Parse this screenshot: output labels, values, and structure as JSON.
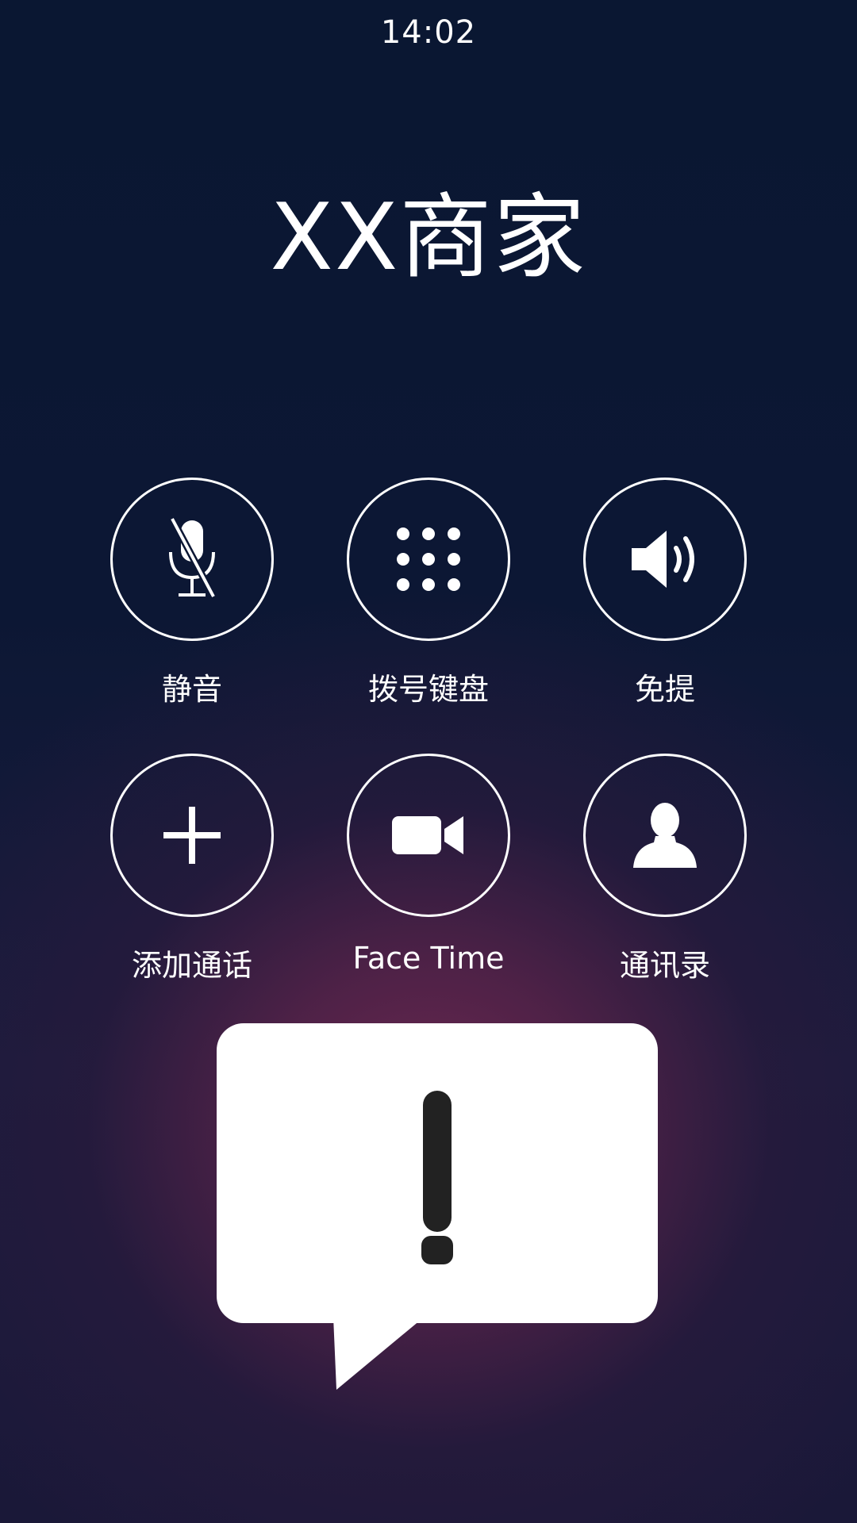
{
  "status_bar": {
    "time": "14:02"
  },
  "call": {
    "caller_name": "XX商家"
  },
  "controls": [
    {
      "label": "静音",
      "icon": "microphone-muted-icon"
    },
    {
      "label": "拨号键盘",
      "icon": "keypad-icon"
    },
    {
      "label": "免提",
      "icon": "speaker-icon"
    },
    {
      "label": "添加通话",
      "icon": "plus-icon"
    },
    {
      "label": "Face Time",
      "icon": "video-camera-icon"
    },
    {
      "label": "通讯录",
      "icon": "contact-person-icon"
    }
  ],
  "alert": {
    "icon": "exclamation-icon",
    "bubble_color": "#ffffff",
    "mark_color": "#222222"
  },
  "colors": {
    "background_top": "#0a1732",
    "background_glow": "#6e2850",
    "foreground": "#ffffff"
  }
}
